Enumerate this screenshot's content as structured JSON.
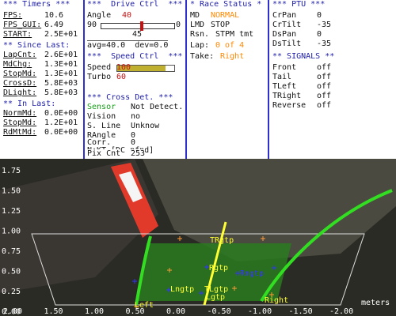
{
  "timers": {
    "header": "*** Timers ***",
    "fps_label": "FPS:",
    "fps_value": "10.6",
    "fps_gui_label": "FPS_GUI:",
    "fps_gui_value": "6.49",
    "start_label": "START:",
    "start_value": "2.5E+01",
    "since_last_header": "** Since Last:",
    "lapcnt_label": "LapCnt:",
    "lapcnt_value": "2.6E+01",
    "mdchg_label": "MdChg:",
    "mdchg_value": "1.3E+01",
    "stopmd_label": "StopMd:",
    "stopmd_value": "1.3E+01",
    "crossd_label": "CrossD:",
    "crossd_value": "5.8E+03",
    "dlight_label": "DLight:",
    "dlight_value": "5.8E+03",
    "in_last_header": "** In Last:",
    "normmd_label": "NormMd:",
    "normmd_value": "0.0E+00",
    "stopmd2_label": "StopMd:",
    "stopmd2_value": "1.2E+01",
    "rdmtmd_label": "RdMtMd:",
    "rdmtmd_value": "0.0E+00"
  },
  "drive": {
    "header": "***  Drive Ctrl  ***",
    "angle_label": "Angle",
    "angle_value": "40",
    "slider_min": "90",
    "slider_max": "0",
    "slider_mid": "45",
    "angle_fraction": 0.556,
    "avg_dev": "avg=40.0  dev=0.0",
    "speed_header": "***  Speed Ctrl  ***",
    "speed_label": "Speed",
    "speed_value": "100",
    "speed_fraction": 0.85,
    "turbo_label": "Turbo",
    "turbo_value": "60",
    "cross_header": "*** Cross Det. ***",
    "sensor_label": "Sensor",
    "sensor_value": "Not Detect.",
    "vision_label": "Vision",
    "vision_value": "no",
    "sline_label": "S. Line",
    "sline_value": "Unknow",
    "rangle_label": "RAngle",
    "rangle_value": "0",
    "corr_label": "Corr.",
    "corr_value": "0",
    "ntkt_label": "N+KT",
    "ntkt_value": "[DC nfnd]",
    "pixcnt_label": "Pix Cnt",
    "pixcnt_value": "253"
  },
  "race": {
    "header": "* Race Status *",
    "md_label": "MD",
    "md_value": "NORMAL",
    "lmd_label": "LMD",
    "lmd_value": "STOP",
    "rsn_label": "Rsn.",
    "rsn_value": "STPM tmt",
    "lap_label": "Lap:",
    "lap_value": "0 of 4",
    "take_label": "Take:",
    "take_value": "Right"
  },
  "ptu": {
    "header": "*** PTU ***",
    "crpan_label": "CrPan",
    "crpan_value": "0",
    "crtilt_label": "CrTilt",
    "crtilt_value": "-35",
    "dspan_label": "DsPan",
    "dspan_value": "0",
    "dstilt_label": "DsTilt",
    "dstilt_value": "-35",
    "signals_header": "** SIGNALS **",
    "front_label": "Front",
    "front_value": "off",
    "tail_label": "Tail",
    "tail_value": "off",
    "tleft_label": "TLeft",
    "tleft_value": "off",
    "tright_label": "TRight",
    "tright_value": "off",
    "reverse_label": "Reverse",
    "reverse_value": "off"
  },
  "overlay": {
    "y_ticks": [
      "1.75",
      "1.50",
      "1.25",
      "1.00",
      "0.75",
      "0.50",
      "0.25",
      "0.00"
    ],
    "x_ticks": [
      "2.00",
      "1.50",
      "1.00",
      "0.50",
      "0.00",
      "-0.50",
      "-1.00",
      "-1.50",
      "-2.00"
    ],
    "units": "meters",
    "labels": {
      "trgtp": "TRgtp",
      "rgtp": "Rgtp",
      "lngtp": "Lngtp",
      "rngtp": "Rngtp",
      "tlgtp": "TLgtp",
      "lgtp": "Lgtp",
      "left": "Left",
      "right": "Right"
    }
  },
  "colors": {
    "accent_blue": "#2f2fd0",
    "red": "#c81010",
    "orange": "#ff8800",
    "green": "#18a018",
    "lane_green": "#33dd22",
    "guide_yellow": "#ffff33"
  }
}
